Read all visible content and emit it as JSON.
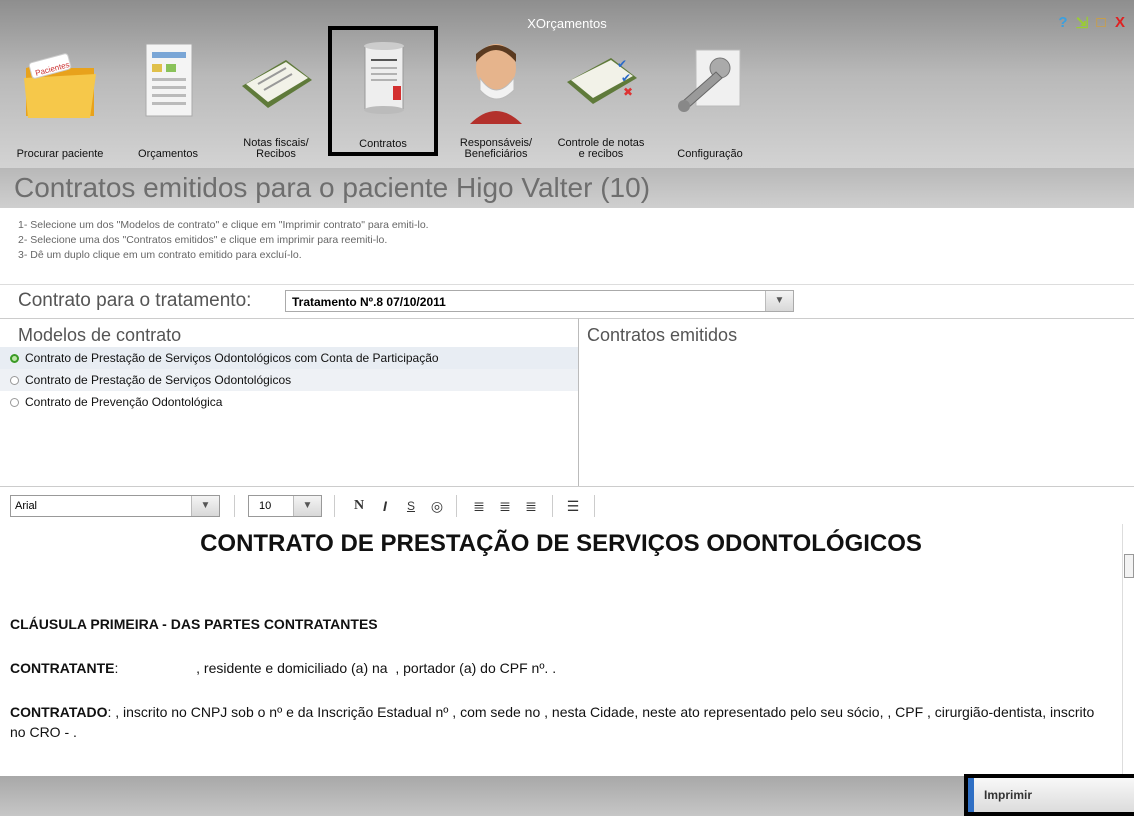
{
  "app": {
    "title": "XOrçamentos"
  },
  "window_controls": {
    "help": "?",
    "minimize": "⇲",
    "maximize": "□",
    "close": "X"
  },
  "toolbar": {
    "items": [
      {
        "label": "Procurar paciente",
        "icon": "folder-icon",
        "folder_tag": "Pacientes"
      },
      {
        "label": "Orçamentos",
        "icon": "budget-sheet-icon"
      },
      {
        "label": "Notas fiscais/ Recibos",
        "icon": "receipt-clipboard-icon"
      },
      {
        "label": "Contratos",
        "icon": "scroll-icon"
      },
      {
        "label": "Responsáveis/ Beneficiários",
        "icon": "person-mask-icon"
      },
      {
        "label": "Controle de notas e recibos",
        "icon": "checklist-icon"
      },
      {
        "label": "Configuração",
        "icon": "wrench-gear-icon"
      }
    ]
  },
  "header": {
    "title": "Contratos emitidos para o paciente Higo Valter (10)"
  },
  "instructions": [
    "1- Selecione um dos \"Modelos de contrato\" e clique em \"Imprimir contrato\" para emiti-lo.",
    "2- Selecione uma dos \"Contratos emitidos\" e clique em imprimir para reemiti-lo.",
    "3- Dê um duplo clique em um contrato emitido para excluí-lo."
  ],
  "treatment": {
    "label": "Contrato para o tratamento:",
    "value": "Tratamento Nº.8 07/10/2011"
  },
  "models": {
    "title": "Modelos de contrato",
    "items": [
      {
        "label": "Contrato de Prestação de Serviços Odontológicos com Conta de Participação",
        "selected": true
      },
      {
        "label": "Contrato de Prestação de Serviços Odontológicos",
        "selected": false
      },
      {
        "label": "Contrato de Prevenção Odontológica",
        "selected": false
      }
    ]
  },
  "issued": {
    "title": "Contratos emitidos"
  },
  "format": {
    "font": "Arial",
    "size": "10",
    "bold": "N",
    "italic": "I",
    "underline": "S"
  },
  "document": {
    "title": "CONTRATO DE PRESTAÇÃO DE SERVIÇOS ODONTOLÓGICOS",
    "clause1": "CLÁUSULA PRIMEIRA - DAS PARTES CONTRATANTES",
    "contratante_label": "CONTRATANTE",
    "contratante_text": ":                    , residente e domiciliado (a) na  , portador (a) do CPF nº. .",
    "contratado_label": "CONTRATADO",
    "contratado_text": ":  , inscrito no CNPJ sob o nº   e da Inscrição Estadual nº , com sede no , nesta Cidade, neste ato representado pelo seu sócio, , CPF , cirurgião-dentista, inscrito no CRO -  ."
  },
  "footer": {
    "print_label": "Imprimir"
  },
  "colors": {
    "accent": "#2f6fc4",
    "selected_radio": "#3a9a25"
  }
}
